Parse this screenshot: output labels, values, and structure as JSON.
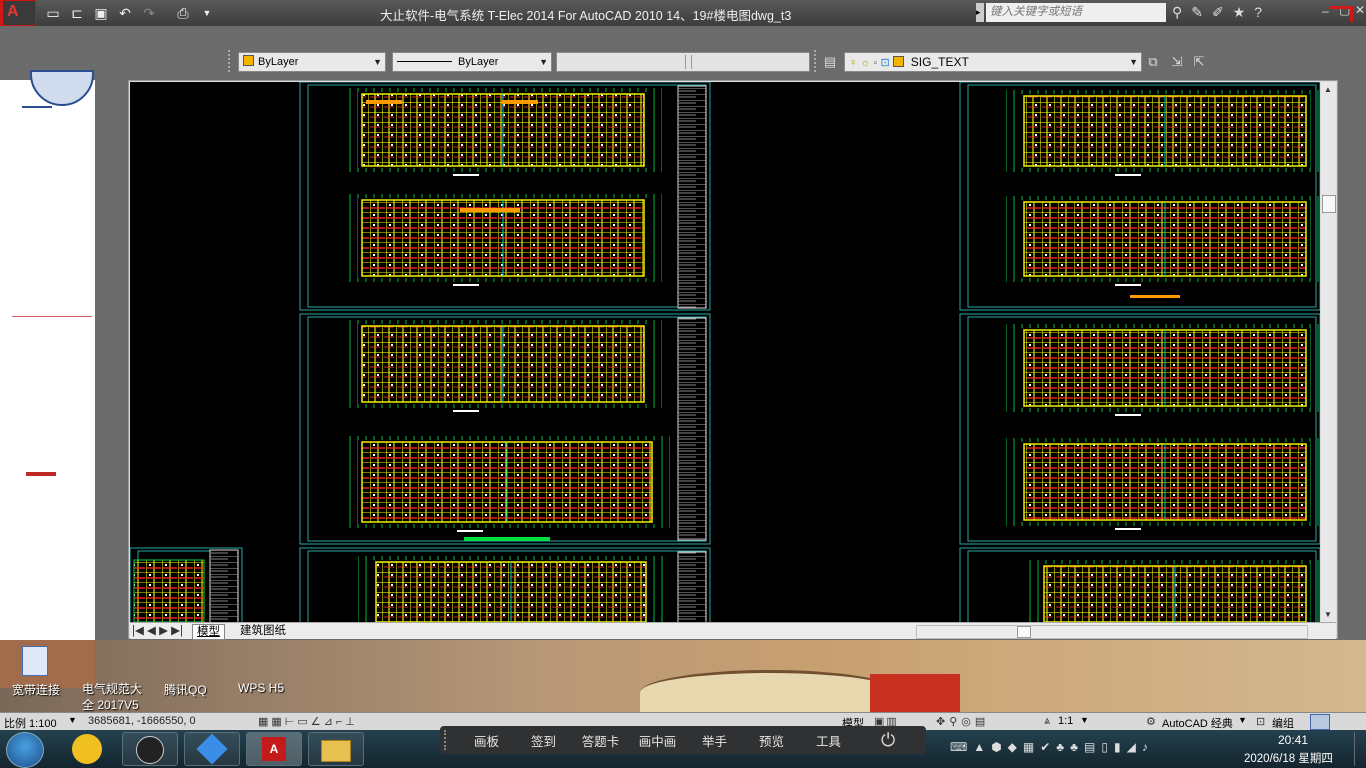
{
  "window": {
    "title": "大止软件-电气系统 T-Elec 2014  For AutoCAD 2010    14、19#楼电图dwg_t3",
    "search_placeholder": "键入关键字或短语",
    "logo_letter": "A"
  },
  "properties_toolbar": {
    "color_value": "ByLayer",
    "linetype_value": "ByLayer",
    "layer_value": "SIG_TEXT"
  },
  "layout_tabs": [
    "模型",
    "建筑图纸"
  ],
  "desktop_icons": [
    {
      "label": "宽带连接"
    },
    {
      "label": "电气规范大全 2017V5"
    },
    {
      "label": "腾讯QQ"
    },
    {
      "label": "WPS H5"
    }
  ],
  "status_bar": {
    "scale": "比例 1:100",
    "coordinates": "3685681,  -1666550,  0",
    "model_label": "模型",
    "annotation_scale": "1:1",
    "workspace": "AutoCAD 经典",
    "edit_label": "编组"
  },
  "class_toolbar": [
    "画板",
    "签到",
    "答题卡",
    "画中画",
    "举手",
    "预览",
    "工具"
  ],
  "clock": {
    "time": "20:41",
    "date": "2020/6/18 星期四"
  },
  "colors": {
    "accent_red": "#d01818",
    "cad_background": "#000000",
    "frame_cyan": "#2aa6a6"
  }
}
